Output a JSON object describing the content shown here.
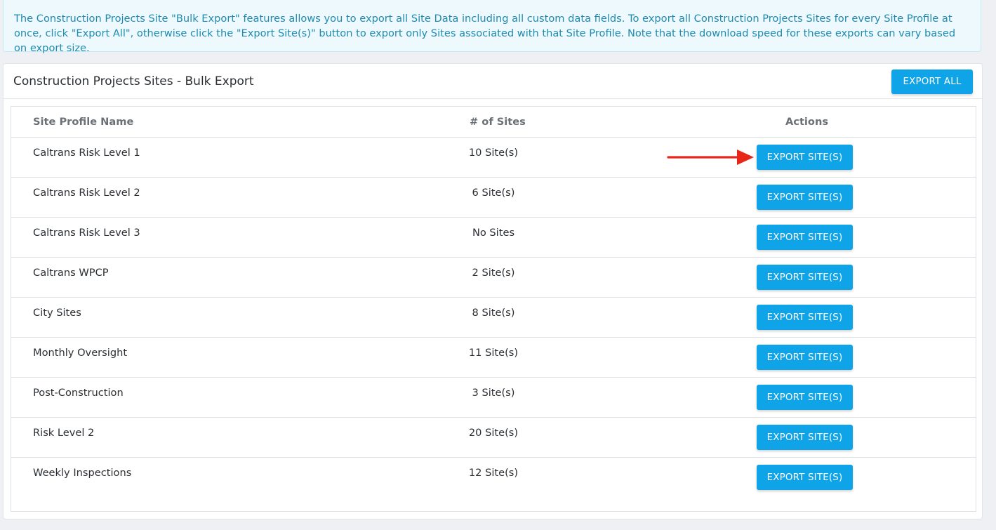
{
  "banner": {
    "text": "The Construction Projects Site \"Bulk Export\" features allows you to export all Site Data including all custom data fields. To export all Construction Projects Sites for every Site Profile at once, click \"Export All\", otherwise click the \"Export Site(s)\" button to export only Sites associated with that Site Profile. Note that the download speed for these exports can vary based on export size."
  },
  "panel": {
    "title": "Construction Projects Sites - Bulk Export",
    "export_all_label": "EXPORT ALL"
  },
  "table": {
    "headers": {
      "name": "Site Profile Name",
      "count": "# of Sites",
      "actions": "Actions"
    },
    "rows": [
      {
        "name": "Caltrans Risk Level 1",
        "count": "10 Site(s)",
        "action": "EXPORT SITE(S)"
      },
      {
        "name": "Caltrans Risk Level 2",
        "count": "6 Site(s)",
        "action": "EXPORT SITE(S)"
      },
      {
        "name": "Caltrans Risk Level 3",
        "count": "No Sites",
        "action": "EXPORT SITE(S)"
      },
      {
        "name": "Caltrans WPCP",
        "count": "2 Site(s)",
        "action": "EXPORT SITE(S)"
      },
      {
        "name": "City Sites",
        "count": "8 Site(s)",
        "action": "EXPORT SITE(S)"
      },
      {
        "name": "Monthly Oversight",
        "count": "11 Site(s)",
        "action": "EXPORT SITE(S)"
      },
      {
        "name": "Post-Construction",
        "count": "3 Site(s)",
        "action": "EXPORT SITE(S)"
      },
      {
        "name": "Risk Level 2",
        "count": "20 Site(s)",
        "action": "EXPORT SITE(S)"
      },
      {
        "name": "Weekly Inspections",
        "count": "12 Site(s)",
        "action": "EXPORT SITE(S)"
      }
    ]
  },
  "annotation": {
    "icon": "red-arrow-icon",
    "color": "#e8271b"
  },
  "colors": {
    "accent": "#0fa3e8",
    "banner_text": "#1f8bb0",
    "banner_bg": "#eef9fd"
  }
}
